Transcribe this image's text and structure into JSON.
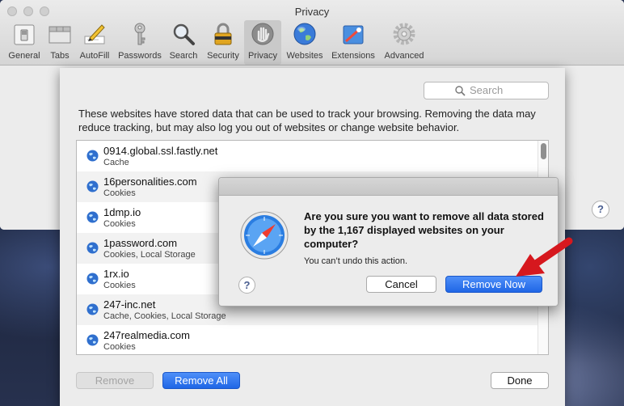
{
  "window": {
    "title": "Privacy"
  },
  "toolbar": {
    "items": [
      {
        "label": "General",
        "icon": "general-switch-icon"
      },
      {
        "label": "Tabs",
        "icon": "tabs-icon"
      },
      {
        "label": "AutoFill",
        "icon": "autofill-pencil-icon"
      },
      {
        "label": "Passwords",
        "icon": "key-icon"
      },
      {
        "label": "Search",
        "icon": "magnifier-icon"
      },
      {
        "label": "Security",
        "icon": "padlock-icon"
      },
      {
        "label": "Privacy",
        "icon": "hand-icon",
        "active": true
      },
      {
        "label": "Websites",
        "icon": "globe-icon"
      },
      {
        "label": "Extensions",
        "icon": "puzzle-icon"
      },
      {
        "label": "Advanced",
        "icon": "gear-icon"
      }
    ]
  },
  "sheet": {
    "search_placeholder": "Search",
    "description": "These websites have stored data that can be used to track your browsing. Removing the data may reduce tracking, but may also log you out of websites or change website behavior.",
    "sites": [
      {
        "name": "0914.global.ssl.fastly.net",
        "data": "Cache"
      },
      {
        "name": "16personalities.com",
        "data": "Cookies"
      },
      {
        "name": "1dmp.io",
        "data": "Cookies"
      },
      {
        "name": "1password.com",
        "data": "Cookies, Local Storage"
      },
      {
        "name": "1rx.io",
        "data": "Cookies"
      },
      {
        "name": "247-inc.net",
        "data": "Cache, Cookies, Local Storage"
      },
      {
        "name": "247realmedia.com",
        "data": "Cookies"
      }
    ],
    "remove_label": "Remove",
    "remove_all_label": "Remove All",
    "done_label": "Done"
  },
  "dialog": {
    "message": "Are you sure you want to remove all data stored by the 1,167 displayed websites on your computer?",
    "informative": "You can’t undo this action.",
    "help_label": "?",
    "cancel_label": "Cancel",
    "confirm_label": "Remove Now",
    "icon": "safari-compass-icon"
  },
  "help_label": "?",
  "colors": {
    "accent": "#1f66e6",
    "arrow": "#d6181e"
  }
}
